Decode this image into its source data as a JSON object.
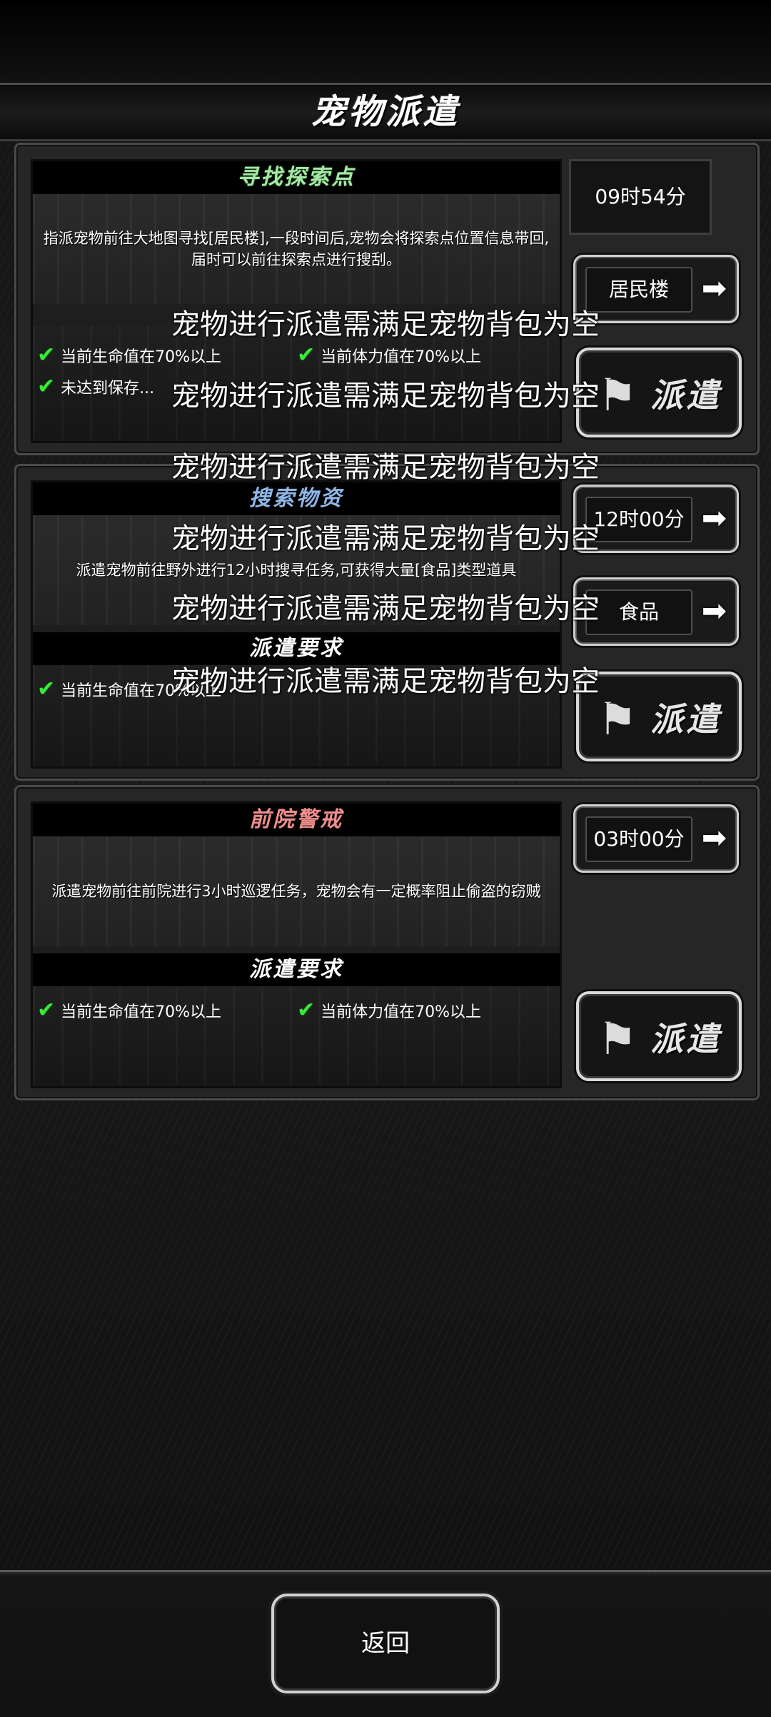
{
  "title": "宠物派遣",
  "cards": [
    {
      "section_title": "寻找探索点",
      "description": "指派宠物前往大地图寻找[居民楼],一段时间后,宠物会将探索点位置信息带回,届时可以前往探索点进行搜刮。",
      "timer": "09时54分",
      "target_select": "居民楼",
      "requirements": [
        "当前生命值在70%以上",
        "当前体力值在70%以上",
        "未达到保存..."
      ],
      "dispatch_label": "派遣"
    },
    {
      "section_title": "搜索物资",
      "description": "派遣宠物前往野外进行12小时搜寻任务,可获得大量[食品]类型道具",
      "duration_select": "12时00分",
      "type_select": "食品",
      "req_header": "派遣要求",
      "requirements": [
        "当前生命值在70%以上"
      ],
      "dispatch_label": "派遣"
    },
    {
      "section_title": "前院警戒",
      "description": "派遣宠物前往前院进行3小时巡逻任务，宠物会有一定概率阻止偷盗的窃贼",
      "duration_select": "03时00分",
      "req_header": "派遣要求",
      "requirements": [
        "当前生命值在70%以上",
        "当前体力值在70%以上"
      ],
      "dispatch_label": "派遣"
    }
  ],
  "toast_message": "宠物进行派遣需满足宠物背包为空",
  "back_label": "返回",
  "icons": {
    "arrow": "arrow-right-icon",
    "check": "check-icon",
    "flag": "flag-icon"
  }
}
